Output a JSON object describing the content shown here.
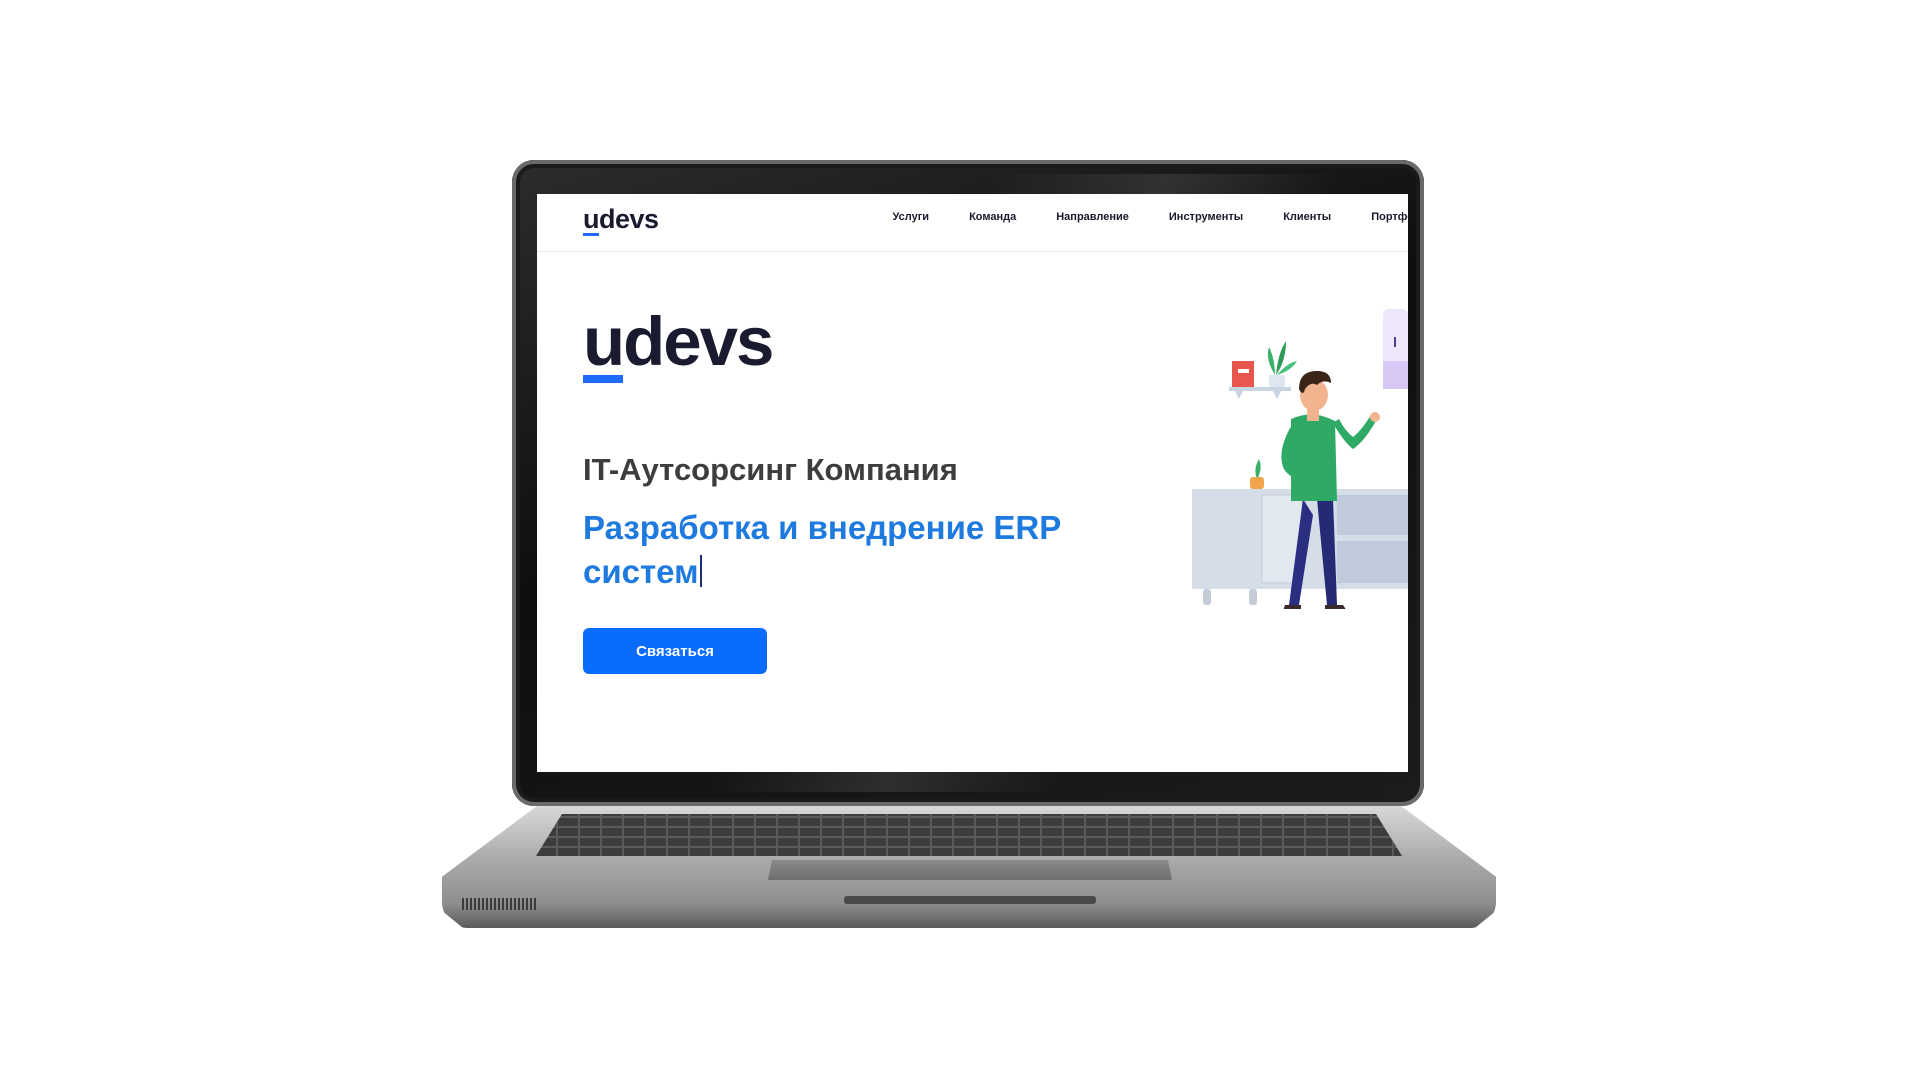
{
  "header": {
    "logo_u": "u",
    "logo_rest": "devs",
    "nav": [
      "Услуги",
      "Команда",
      "Направление",
      "Инструменты",
      "Клиенты",
      "Портфо"
    ]
  },
  "hero": {
    "logo_u": "u",
    "logo_rest": "devs",
    "subtitle": "IT-Аутсорсинг Компания",
    "title": "Разработка и внедрение ERP систем",
    "cta_label": "Связаться"
  },
  "colors": {
    "brand_dark": "#1a1b2f",
    "accent_blue": "#1f6bff",
    "title_blue": "#1f7ae0",
    "button_blue": "#0a6cff",
    "subtitle_gray": "#3d3d3d"
  },
  "icons": [
    "laptop-frame",
    "person-illustration",
    "plant-icon",
    "book-icon",
    "cabinet-illustration"
  ]
}
